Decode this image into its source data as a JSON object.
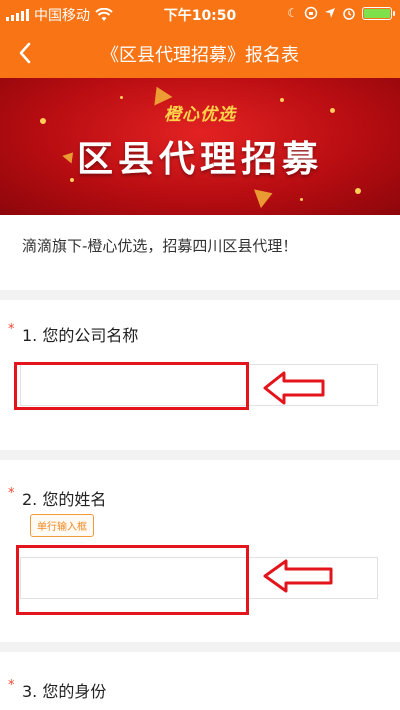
{
  "status_bar": {
    "carrier": "中国移动",
    "time": "下午10:50",
    "battery_level": 1.0,
    "icons": [
      "signal-icon",
      "wifi-icon",
      "moon-icon",
      "lock-rotation-icon",
      "location-icon",
      "alarm-icon",
      "battery-icon"
    ]
  },
  "nav": {
    "title": "《区县代理招募》报名表",
    "back_icon": "chevron-left-icon"
  },
  "banner": {
    "subtitle": "橙心优选",
    "title": "区县代理招募"
  },
  "intro": {
    "text": "滴滴旗下-橙心优选，招募四川区县代理！"
  },
  "questions": [
    {
      "required_mark": "*",
      "label": "1. 您的公司名称",
      "value": "",
      "tag": ""
    },
    {
      "required_mark": "*",
      "label": "2. 您的姓名",
      "value": "",
      "tag": "单行输入框"
    },
    {
      "required_mark": "*",
      "label": "3. 您的身份",
      "value": "",
      "tag": ""
    }
  ],
  "colors": {
    "brand": "#f87414",
    "banner_red": "#c4121a",
    "banner_gold": "#ffd34a",
    "highlight": "#e3141b",
    "required": "#e8452c"
  }
}
